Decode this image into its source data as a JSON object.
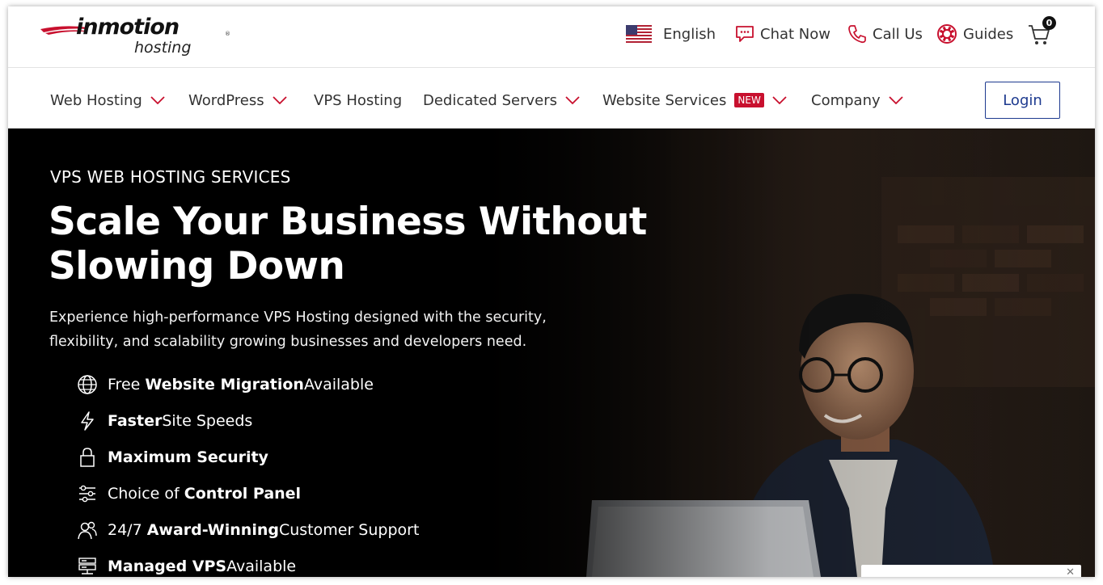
{
  "brand": {
    "name": "inmotion",
    "sub": "hosting",
    "reg": "®"
  },
  "utility": {
    "language": "English",
    "chat": "Chat Now",
    "call": "Call Us",
    "guides": "Guides",
    "cart_count": "0"
  },
  "nav": {
    "items": [
      {
        "label": "Web Hosting",
        "has_menu": true
      },
      {
        "label": "WordPress",
        "has_menu": true
      },
      {
        "label": "VPS Hosting",
        "has_menu": false
      },
      {
        "label": "Dedicated Servers",
        "has_menu": true
      },
      {
        "label": "Website Services",
        "badge": "NEW",
        "has_menu": true
      },
      {
        "label": "Company",
        "has_menu": true
      }
    ],
    "login": "Login"
  },
  "hero": {
    "eyebrow": "VPS WEB HOSTING SERVICES",
    "headline_line1": "Scale Your Business Without",
    "headline_line2": "Slowing Down",
    "description_line1": "Experience high-performance VPS Hosting designed with the security,",
    "description_line2": "flexibility, and scalability growing businesses and developers need.",
    "features": [
      {
        "icon": "globe-icon",
        "pre": "Free ",
        "bold": "Website Migration",
        "post": " Available"
      },
      {
        "icon": "lightning-icon",
        "pre": "",
        "bold": "Faster",
        "post": " Site Speeds"
      },
      {
        "icon": "lock-icon",
        "pre": "",
        "bold": "Maximum Security",
        "post": ""
      },
      {
        "icon": "sliders-icon",
        "pre": "Choice of ",
        "bold": "Control Panel",
        "post": ""
      },
      {
        "icon": "users-icon",
        "pre": "24/7 ",
        "bold": "Award-Winning",
        "post": " Customer Support"
      },
      {
        "icon": "server-icon",
        "pre": "",
        "bold": "Managed VPS",
        "post": " Available"
      }
    ]
  },
  "colors": {
    "accent_red": "#c8102e",
    "login_blue": "#1d3a8f",
    "hero_bg": "#000000"
  }
}
